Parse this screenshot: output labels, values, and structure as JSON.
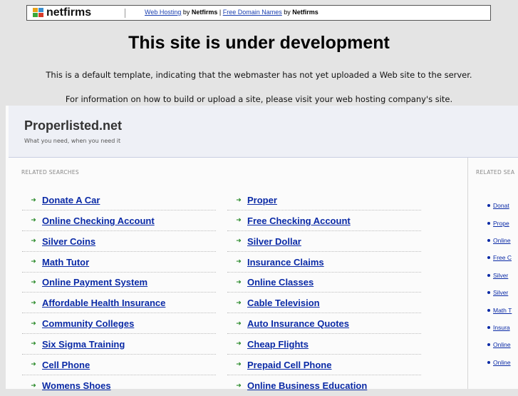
{
  "netfirms_bar": {
    "logo_text": "netfirms",
    "link1": "Web Hosting",
    "by1": " by ",
    "brand1": "Netfirms",
    "divider": " | ",
    "link2": "Free Domain Names",
    "by2": " by ",
    "brand2": "Netfirms"
  },
  "title": "This site is under development",
  "paragraph1": "This is a default template, indicating that the webmaster has not yet uploaded a Web site to the server.",
  "paragraph2": "For information on how to build or upload a site, please visit your web hosting company's site.",
  "parked": {
    "site_name": "Properlisted.net",
    "tagline": "What you need, when you need it",
    "related_label": "RELATED SEARCHES",
    "related_label_side": "RELATED SEA",
    "left_links": [
      "Donate A Car",
      "Online Checking Account",
      "Silver Coins",
      "Math Tutor",
      "Online Payment System",
      "Affordable Health Insurance",
      "Community Colleges",
      "Six Sigma Training",
      "Cell Phone",
      "Womens Shoes"
    ],
    "right_links": [
      "Proper",
      "Free Checking Account",
      "Silver Dollar",
      "Insurance Claims",
      "Online Classes",
      "Cable Television",
      "Auto Insurance Quotes",
      "Cheap Flights",
      "Prepaid Cell Phone",
      "Online Business Education"
    ],
    "side_links": [
      "Donat",
      "Prope",
      "Online",
      "Free C",
      "Silver",
      "Silver",
      "Math T",
      "Insura",
      "Online",
      "Online"
    ]
  }
}
